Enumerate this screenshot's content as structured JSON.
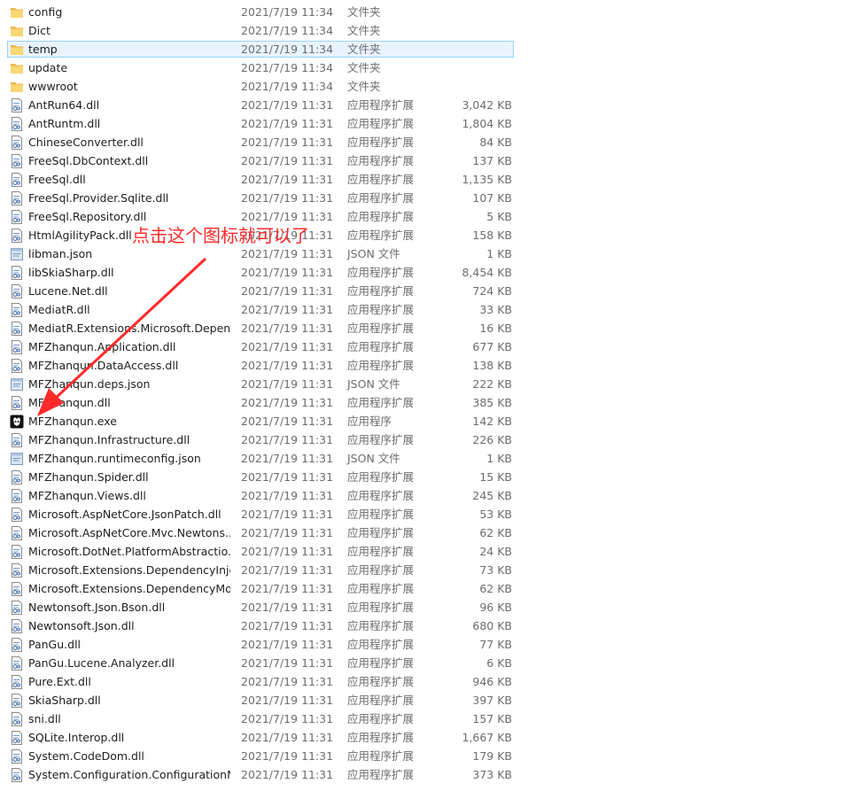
{
  "annotation": {
    "text": "点击这个图标就可以了",
    "color": "#ff2a2a"
  },
  "selected_index": 2,
  "rows": [
    {
      "name": "config",
      "date": "2021/7/19 11:34",
      "type": "文件夹",
      "size": "",
      "icon": "folder-icon"
    },
    {
      "name": "Dict",
      "date": "2021/7/19 11:34",
      "type": "文件夹",
      "size": "",
      "icon": "folder-icon"
    },
    {
      "name": "temp",
      "date": "2021/7/19 11:34",
      "type": "文件夹",
      "size": "",
      "icon": "folder-icon"
    },
    {
      "name": "update",
      "date": "2021/7/19 11:34",
      "type": "文件夹",
      "size": "",
      "icon": "folder-icon"
    },
    {
      "name": "wwwroot",
      "date": "2021/7/19 11:34",
      "type": "文件夹",
      "size": "",
      "icon": "folder-icon"
    },
    {
      "name": "AntRun64.dll",
      "date": "2021/7/19 11:31",
      "type": "应用程序扩展",
      "size": "3,042 KB",
      "icon": "dll-icon"
    },
    {
      "name": "AntRuntm.dll",
      "date": "2021/7/19 11:31",
      "type": "应用程序扩展",
      "size": "1,804 KB",
      "icon": "dll-icon"
    },
    {
      "name": "ChineseConverter.dll",
      "date": "2021/7/19 11:31",
      "type": "应用程序扩展",
      "size": "84 KB",
      "icon": "dll-icon"
    },
    {
      "name": "FreeSql.DbContext.dll",
      "date": "2021/7/19 11:31",
      "type": "应用程序扩展",
      "size": "137 KB",
      "icon": "dll-icon"
    },
    {
      "name": "FreeSql.dll",
      "date": "2021/7/19 11:31",
      "type": "应用程序扩展",
      "size": "1,135 KB",
      "icon": "dll-icon"
    },
    {
      "name": "FreeSql.Provider.Sqlite.dll",
      "date": "2021/7/19 11:31",
      "type": "应用程序扩展",
      "size": "107 KB",
      "icon": "dll-icon"
    },
    {
      "name": "FreeSql.Repository.dll",
      "date": "2021/7/19 11:31",
      "type": "应用程序扩展",
      "size": "5 KB",
      "icon": "dll-icon"
    },
    {
      "name": "HtmlAgilityPack.dll",
      "date": "2021/7/19 11:31",
      "type": "应用程序扩展",
      "size": "158 KB",
      "icon": "dll-icon"
    },
    {
      "name": "libman.json",
      "date": "2021/7/19 11:31",
      "type": "JSON 文件",
      "size": "1 KB",
      "icon": "json-file-icon"
    },
    {
      "name": "libSkiaSharp.dll",
      "date": "2021/7/19 11:31",
      "type": "应用程序扩展",
      "size": "8,454 KB",
      "icon": "dll-icon"
    },
    {
      "name": "Lucene.Net.dll",
      "date": "2021/7/19 11:31",
      "type": "应用程序扩展",
      "size": "724 KB",
      "icon": "dll-icon"
    },
    {
      "name": "MediatR.dll",
      "date": "2021/7/19 11:31",
      "type": "应用程序扩展",
      "size": "33 KB",
      "icon": "dll-icon"
    },
    {
      "name": "MediatR.Extensions.Microsoft.Depen...",
      "date": "2021/7/19 11:31",
      "type": "应用程序扩展",
      "size": "16 KB",
      "icon": "dll-icon"
    },
    {
      "name": "MFZhanqun.Application.dll",
      "date": "2021/7/19 11:31",
      "type": "应用程序扩展",
      "size": "677 KB",
      "icon": "dll-icon"
    },
    {
      "name": "MFZhanqun.DataAccess.dll",
      "date": "2021/7/19 11:31",
      "type": "应用程序扩展",
      "size": "138 KB",
      "icon": "dll-icon"
    },
    {
      "name": "MFZhanqun.deps.json",
      "date": "2021/7/19 11:31",
      "type": "JSON 文件",
      "size": "222 KB",
      "icon": "json-file-icon"
    },
    {
      "name": "MFZhanqun.dll",
      "date": "2021/7/19 11:31",
      "type": "应用程序扩展",
      "size": "385 KB",
      "icon": "dll-icon"
    },
    {
      "name": "MFZhanqun.exe",
      "date": "2021/7/19 11:31",
      "type": "应用程序",
      "size": "142 KB",
      "icon": "exe-app-icon"
    },
    {
      "name": "MFZhanqun.Infrastructure.dll",
      "date": "2021/7/19 11:31",
      "type": "应用程序扩展",
      "size": "226 KB",
      "icon": "dll-icon"
    },
    {
      "name": "MFZhanqun.runtimeconfig.json",
      "date": "2021/7/19 11:31",
      "type": "JSON 文件",
      "size": "1 KB",
      "icon": "json-file-icon"
    },
    {
      "name": "MFZhanqun.Spider.dll",
      "date": "2021/7/19 11:31",
      "type": "应用程序扩展",
      "size": "15 KB",
      "icon": "dll-icon"
    },
    {
      "name": "MFZhanqun.Views.dll",
      "date": "2021/7/19 11:31",
      "type": "应用程序扩展",
      "size": "245 KB",
      "icon": "dll-icon"
    },
    {
      "name": "Microsoft.AspNetCore.JsonPatch.dll",
      "date": "2021/7/19 11:31",
      "type": "应用程序扩展",
      "size": "53 KB",
      "icon": "dll-icon"
    },
    {
      "name": "Microsoft.AspNetCore.Mvc.Newtons...",
      "date": "2021/7/19 11:31",
      "type": "应用程序扩展",
      "size": "62 KB",
      "icon": "dll-icon"
    },
    {
      "name": "Microsoft.DotNet.PlatformAbstractio...",
      "date": "2021/7/19 11:31",
      "type": "应用程序扩展",
      "size": "24 KB",
      "icon": "dll-icon"
    },
    {
      "name": "Microsoft.Extensions.DependencyInje...",
      "date": "2021/7/19 11:31",
      "type": "应用程序扩展",
      "size": "73 KB",
      "icon": "dll-icon"
    },
    {
      "name": "Microsoft.Extensions.DependencyMo...",
      "date": "2021/7/19 11:31",
      "type": "应用程序扩展",
      "size": "62 KB",
      "icon": "dll-icon"
    },
    {
      "name": "Newtonsoft.Json.Bson.dll",
      "date": "2021/7/19 11:31",
      "type": "应用程序扩展",
      "size": "96 KB",
      "icon": "dll-icon"
    },
    {
      "name": "Newtonsoft.Json.dll",
      "date": "2021/7/19 11:31",
      "type": "应用程序扩展",
      "size": "680 KB",
      "icon": "dll-icon"
    },
    {
      "name": "PanGu.dll",
      "date": "2021/7/19 11:31",
      "type": "应用程序扩展",
      "size": "77 KB",
      "icon": "dll-icon"
    },
    {
      "name": "PanGu.Lucene.Analyzer.dll",
      "date": "2021/7/19 11:31",
      "type": "应用程序扩展",
      "size": "6 KB",
      "icon": "dll-icon"
    },
    {
      "name": "Pure.Ext.dll",
      "date": "2021/7/19 11:31",
      "type": "应用程序扩展",
      "size": "946 KB",
      "icon": "dll-icon"
    },
    {
      "name": "SkiaSharp.dll",
      "date": "2021/7/19 11:31",
      "type": "应用程序扩展",
      "size": "397 KB",
      "icon": "dll-icon"
    },
    {
      "name": "sni.dll",
      "date": "2021/7/19 11:31",
      "type": "应用程序扩展",
      "size": "157 KB",
      "icon": "dll-icon"
    },
    {
      "name": "SQLite.Interop.dll",
      "date": "2021/7/19 11:31",
      "type": "应用程序扩展",
      "size": "1,667 KB",
      "icon": "dll-icon"
    },
    {
      "name": "System.CodeDom.dll",
      "date": "2021/7/19 11:31",
      "type": "应用程序扩展",
      "size": "179 KB",
      "icon": "dll-icon"
    },
    {
      "name": "System.Configuration.ConfigurationM...",
      "date": "2021/7/19 11:31",
      "type": "应用程序扩展",
      "size": "373 KB",
      "icon": "dll-icon"
    }
  ]
}
